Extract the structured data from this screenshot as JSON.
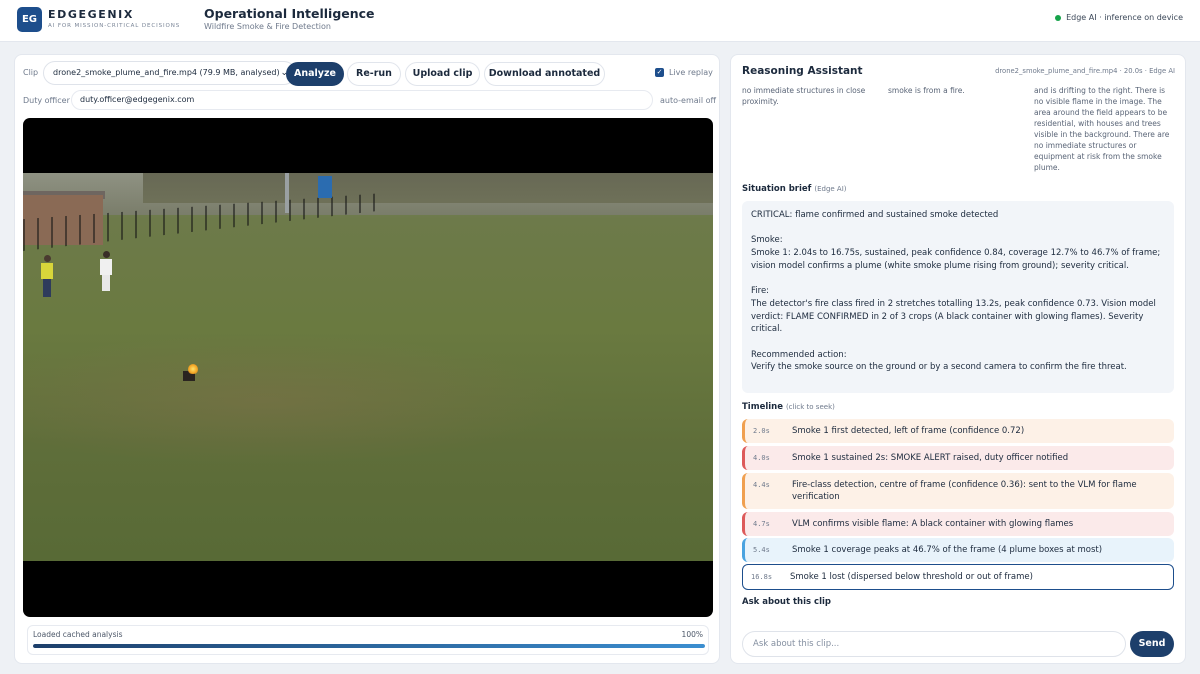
{
  "header": {
    "logo": "EG",
    "brand_name": "EDGEGENIX",
    "brand_tagline": "AI FOR MISSION-CRITICAL DECISIONS",
    "title": "Operational Intelligence",
    "subtitle": "Wildfire Smoke & Fire Detection",
    "status_text": "Edge AI · inference on device",
    "status_color": "#16a34a"
  },
  "controls": {
    "clip_label": "Clip",
    "clip_value": "drone2_smoke_plume_and_fire.mp4 (79.9 MB, analysed)",
    "analyze": "Analyze",
    "rerun": "Re-run",
    "upload": "Upload clip",
    "download": "Download annotated",
    "live_replay": "Live replay",
    "live_replay_checked": true,
    "duty_label": "Duty officer",
    "duty_value": "duty.officer@edgegenix.com",
    "auto_email": "auto-email off"
  },
  "progress": {
    "text": "Loaded cached analysis",
    "percent_label": "100%",
    "value": 1.0
  },
  "assistant": {
    "title": "Reasoning Assistant",
    "meta": "drone2_smoke_plume_and_fire.mp4 · 20.0s · Edge AI",
    "fragments": [
      "no immediate structures in close proximity.",
      "smoke is from a fire.",
      "and is drifting to the right. There is no visible flame in the image. The area around the field appears to be residential, with houses and trees visible in the background. There are no immediate structures or equipment at risk from the smoke plume."
    ],
    "brief_title": "Situation brief",
    "brief_sub": "(Edge AI)",
    "brief_paragraphs": [
      "CRITICAL: flame confirmed and sustained smoke detected",
      "Smoke:\nSmoke 1: 2.04s to 16.75s, sustained, peak confidence 0.84, coverage 12.7% to 46.7% of frame; vision model confirms a plume (white smoke plume rising from ground); severity critical.",
      "Fire:\nThe detector's fire class fired in 2 stretches totalling 13.2s, peak confidence 0.73. Vision model verdict: FLAME CONFIRMED in 2 of 3 crops (A black container with glowing flames). Severity critical.",
      "Recommended action:\nVerify the smoke source on the ground or by a second camera to confirm the fire threat."
    ],
    "timeline_title": "Timeline",
    "timeline_sub": "(click to seek)",
    "timeline": [
      {
        "time": "2.0s",
        "text": "Smoke 1 first detected, left of frame (confidence 0.72)",
        "color": "orange"
      },
      {
        "time": "4.0s",
        "text": "Smoke 1 sustained 2s: SMOKE ALERT raised, duty officer notified",
        "color": "red"
      },
      {
        "time": "4.4s",
        "text": "Fire-class detection, centre of frame (confidence 0.36): sent to the VLM for flame verification",
        "color": "orange"
      },
      {
        "time": "4.7s",
        "text": "VLM confirms visible flame: A black container with glowing flames",
        "color": "red"
      },
      {
        "time": "5.4s",
        "text": "Smoke 1 coverage peaks at 46.7% of the frame (4 plume boxes at most)",
        "color": "blue"
      },
      {
        "time": "16.8s",
        "text": "Smoke 1 lost (dispersed below threshold or out of frame)",
        "color": "selected"
      }
    ],
    "ask_title": "Ask about this clip",
    "ask_placeholder": "Ask about this clip...",
    "send": "Send"
  }
}
